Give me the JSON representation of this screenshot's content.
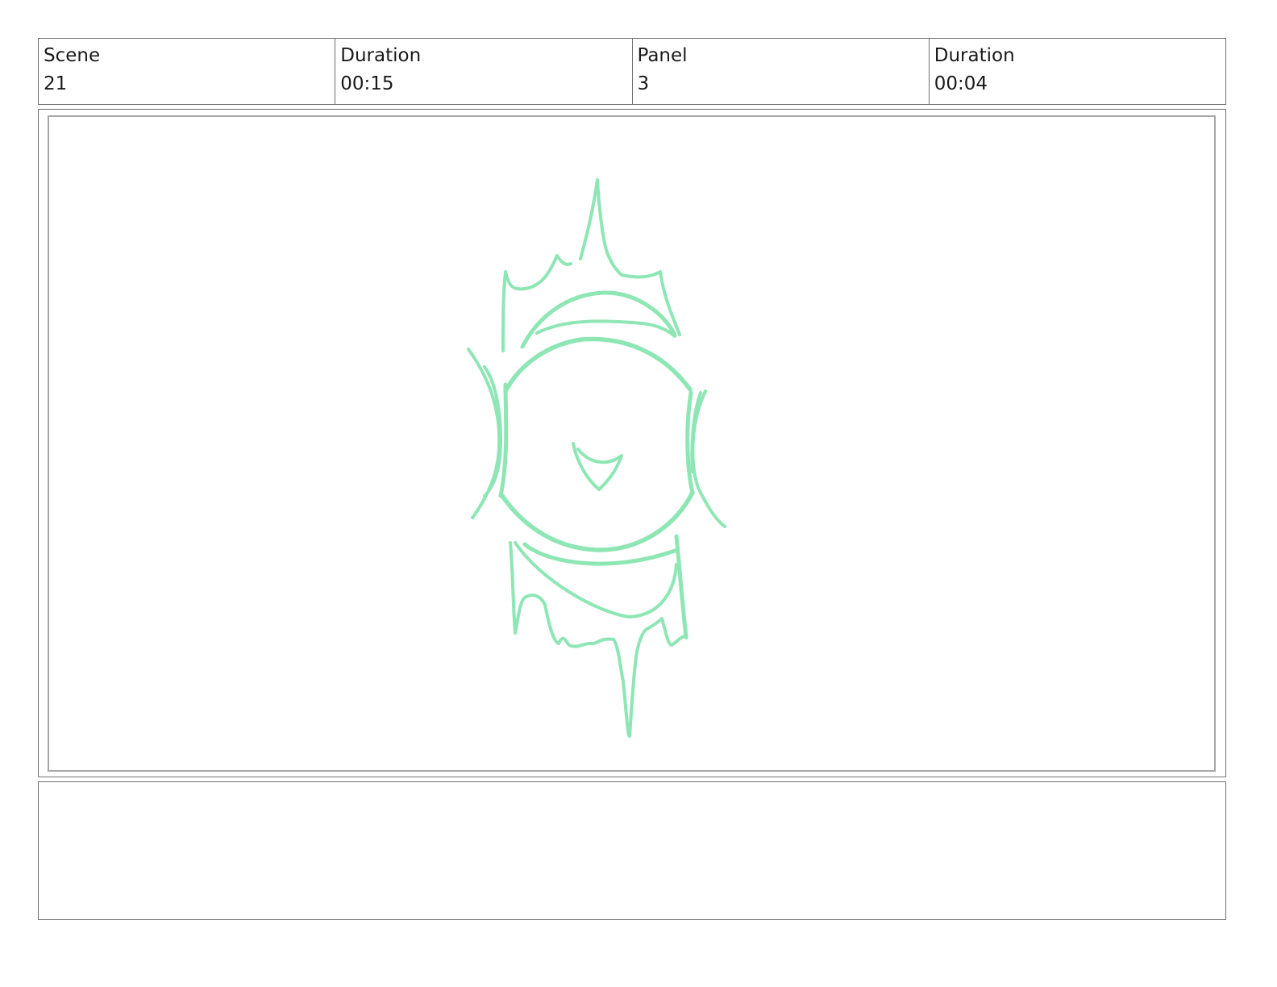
{
  "header": {
    "scene": {
      "label": "Scene",
      "value": "21"
    },
    "scene_duration": {
      "label": "Duration",
      "value": "00:15"
    },
    "panel": {
      "label": "Panel",
      "value": "3"
    },
    "panel_duration": {
      "label": "Duration",
      "value": "00:04"
    }
  },
  "frame": {
    "sketch_color": "#8ee6b5",
    "frame_border_color": "#a8a8a8",
    "sketch_subject": "eye-sketch"
  },
  "notes": {
    "text": ""
  }
}
